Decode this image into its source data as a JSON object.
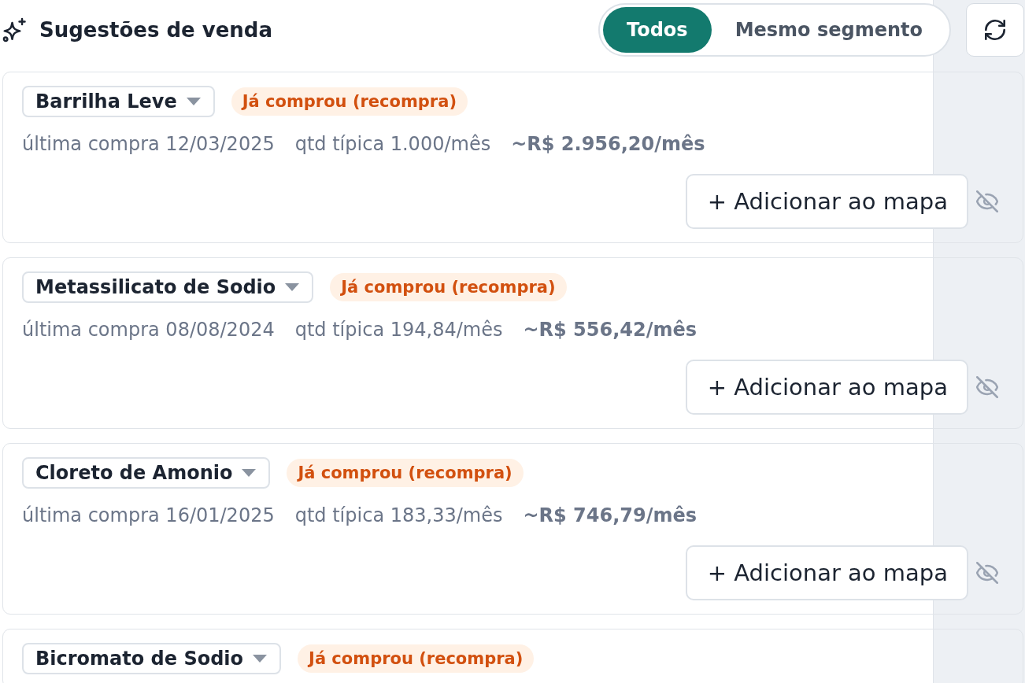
{
  "header": {
    "title": "Sugestões de venda",
    "filter_tabs": [
      {
        "label": "Todos",
        "selected": true
      },
      {
        "label": "Mesmo segmento",
        "selected": false
      }
    ]
  },
  "suggestions": [
    {
      "product": "Barrilha Leve",
      "tag": "Já comprou (recompra)",
      "last_purchase": "última compra 12/03/2025",
      "typical_quantity": "qtd típica 1.000/mês",
      "estimated_value": "~R$ 2.956,20/mês",
      "action": "+ Adicionar ao mapa"
    },
    {
      "product": "Metassilicato de Sodio",
      "tag": "Já comprou (recompra)",
      "last_purchase": "última compra 08/08/2024",
      "typical_quantity": "qtd típica 194,84/mês",
      "estimated_value": "~R$ 556,42/mês",
      "action": "+ Adicionar ao mapa"
    },
    {
      "product": "Cloreto de Amonio",
      "tag": "Já comprou (recompra)",
      "last_purchase": "última compra 16/01/2025",
      "typical_quantity": "qtd típica 183,33/mês",
      "estimated_value": "~R$ 746,79/mês",
      "action": "+ Adicionar ao mapa"
    },
    {
      "product": "Bicromato de Sodio",
      "tag": "Já comprou (recompra)"
    }
  ]
}
